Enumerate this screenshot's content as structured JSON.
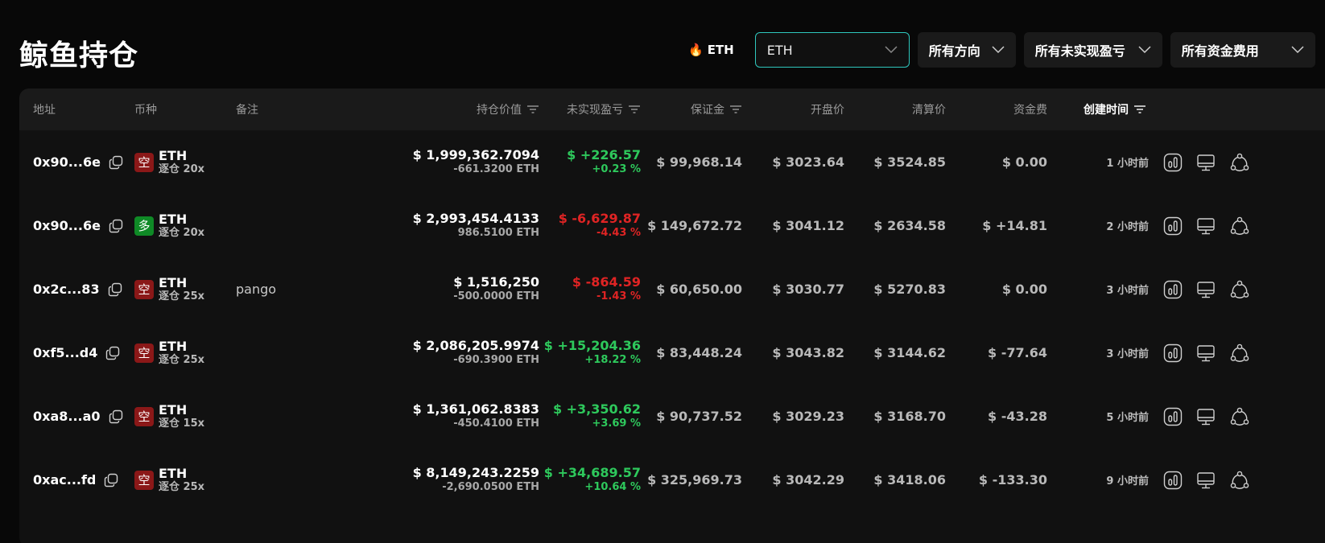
{
  "page_title": "鲸鱼持仓",
  "filters": {
    "hot_label": "ETH",
    "coin_select": "ETH",
    "direction": "所有方向",
    "pnl": "所有未实现盈亏",
    "funding": "所有资金费用"
  },
  "columns": {
    "address": "地址",
    "coin": "币种",
    "note": "备注",
    "position_value": "持仓价值",
    "unrealized_pnl": "未实现盈亏",
    "margin": "保证金",
    "entry_price": "开盘价",
    "liq_price": "清算价",
    "funding": "资金费",
    "created": "创建时间"
  },
  "colors": {
    "accent": "#2fc7bd",
    "positive": "#2ec95c",
    "negative": "#e02424",
    "short": "#8b1818",
    "long": "#0f8a26"
  },
  "rows": [
    {
      "address": "0x90...6e",
      "side": "空",
      "side_type": "short",
      "coin": "ETH",
      "leverage": "逐仓 20x",
      "note": "",
      "value": "$ 1,999,362.7094",
      "qty": "-661.3200 ETH",
      "pnl": "$ +226.57",
      "pnl_pct": "+0.23 %",
      "pnl_sign": "pos",
      "margin": "$ 99,968.14",
      "entry": "$ 3023.64",
      "liq": "$ 3524.85",
      "funding": "$ 0.00",
      "funding_sign": "zero",
      "time": "1 小时前"
    },
    {
      "address": "0x90...6e",
      "side": "多",
      "side_type": "long",
      "coin": "ETH",
      "leverage": "逐仓 20x",
      "note": "",
      "value": "$ 2,993,454.4133",
      "qty": "986.5100 ETH",
      "pnl": "$ -6,629.87",
      "pnl_pct": "-4.43 %",
      "pnl_sign": "neg",
      "margin": "$ 149,672.72",
      "entry": "$ 3041.12",
      "liq": "$ 2634.58",
      "funding": "$ +14.81",
      "funding_sign": "pos",
      "time": "2 小时前"
    },
    {
      "address": "0x2c...83",
      "side": "空",
      "side_type": "short",
      "coin": "ETH",
      "leverage": "逐仓 25x",
      "note": "pango",
      "value": "$ 1,516,250",
      "qty": "-500.0000 ETH",
      "pnl": "$ -864.59",
      "pnl_pct": "-1.43 %",
      "pnl_sign": "neg",
      "margin": "$ 60,650.00",
      "entry": "$ 3030.77",
      "liq": "$ 5270.83",
      "funding": "$ 0.00",
      "funding_sign": "zero",
      "time": "3 小时前"
    },
    {
      "address": "0xf5...d4",
      "side": "空",
      "side_type": "short",
      "coin": "ETH",
      "leverage": "逐仓 25x",
      "note": "",
      "value": "$ 2,086,205.9974",
      "qty": "-690.3900 ETH",
      "pnl": "$ +15,204.36",
      "pnl_pct": "+18.22 %",
      "pnl_sign": "pos",
      "margin": "$ 83,448.24",
      "entry": "$ 3043.82",
      "liq": "$ 3144.62",
      "funding": "$ -77.64",
      "funding_sign": "neg",
      "time": "3 小时前"
    },
    {
      "address": "0xa8...a0",
      "side": "空",
      "side_type": "short",
      "coin": "ETH",
      "leverage": "逐仓 15x",
      "note": "",
      "value": "$ 1,361,062.8383",
      "qty": "-450.4100 ETH",
      "pnl": "$ +3,350.62",
      "pnl_pct": "+3.69 %",
      "pnl_sign": "pos",
      "margin": "$ 90,737.52",
      "entry": "$ 3029.23",
      "liq": "$ 3168.70",
      "funding": "$ -43.28",
      "funding_sign": "neg",
      "time": "5 小时前"
    },
    {
      "address": "0xac...fd",
      "side": "空",
      "side_type": "short",
      "coin": "ETH",
      "leverage": "逐仓 25x",
      "note": "",
      "value": "$ 8,149,243.2259",
      "qty": "-2,690.0500 ETH",
      "pnl": "$ +34,689.57",
      "pnl_pct": "+10.64 %",
      "pnl_sign": "pos",
      "margin": "$ 325,969.73",
      "entry": "$ 3042.29",
      "liq": "$ 3418.06",
      "funding": "$ -133.30",
      "funding_sign": "neg",
      "time": "9 小时前"
    }
  ]
}
